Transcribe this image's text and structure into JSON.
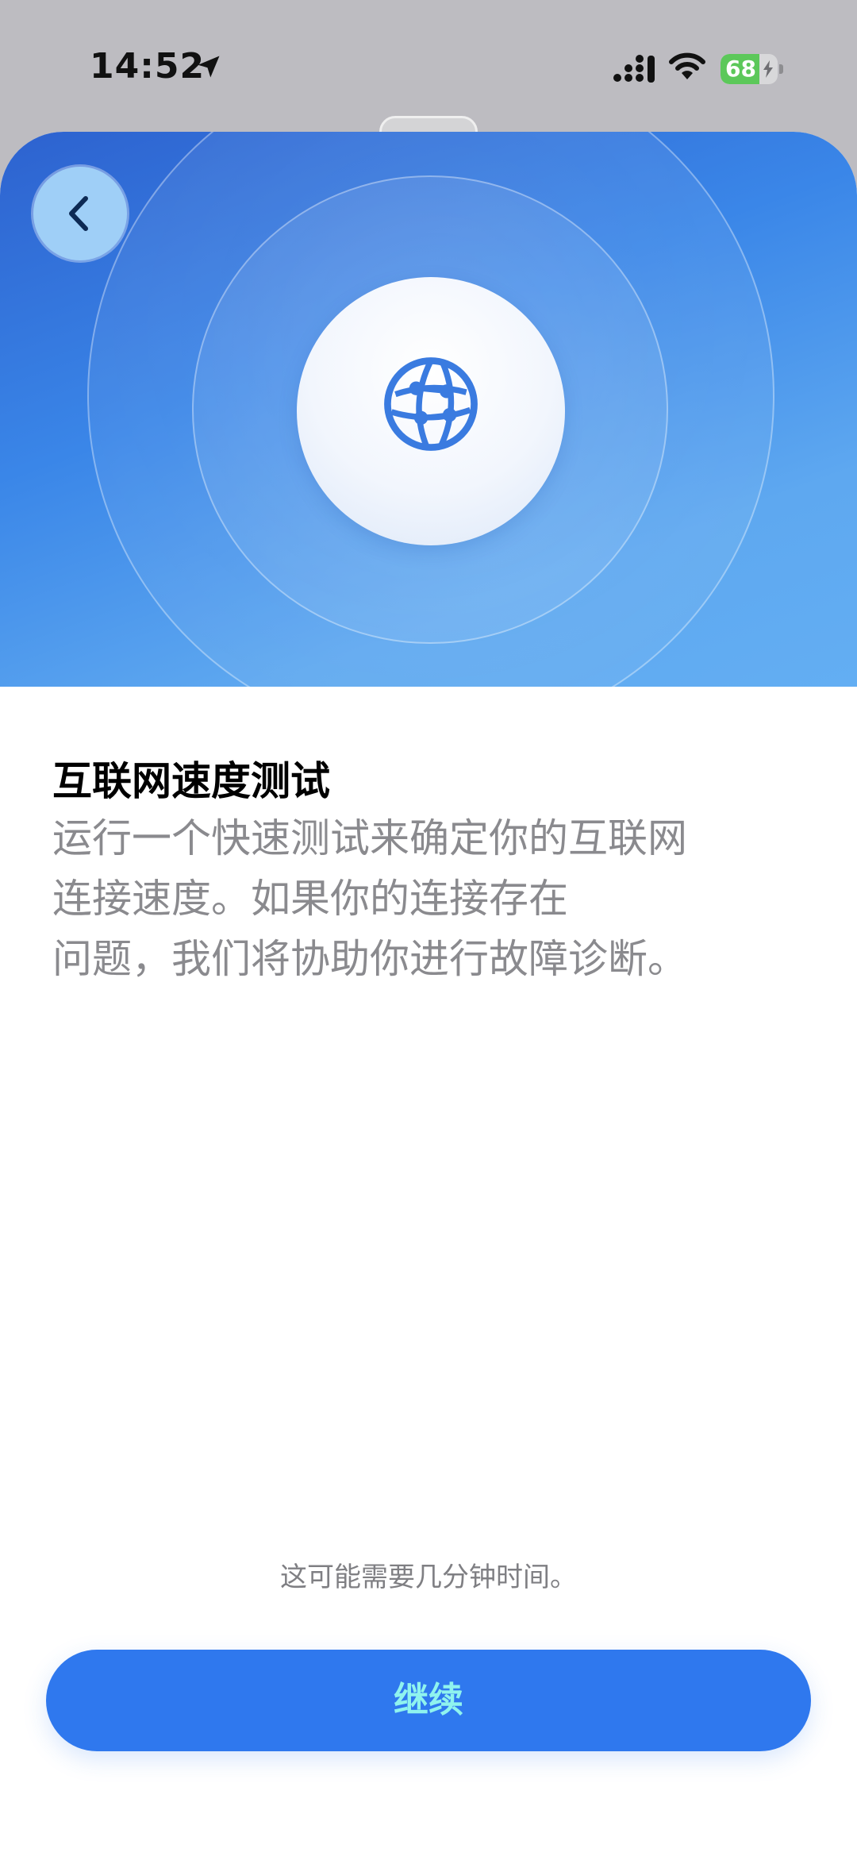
{
  "status_bar": {
    "time": "14:52",
    "battery_level": "68",
    "battery_fraction": 0.68,
    "icons": [
      "location-arrow-icon",
      "cellular-signal-icon",
      "wifi-icon",
      "battery-charging-icon"
    ]
  },
  "hero": {
    "icon": "globe-icon",
    "back_icon": "chevron-left-icon",
    "colors": {
      "gradient_start": "#2d62cf",
      "gradient_end": "#63aef3",
      "globe": "#3a7be0"
    }
  },
  "content": {
    "title": "互联网速度测试",
    "description": "运行一个快速测试来确定你的互联网\n连接速度。如果你的连接存在\n问题，我们将协助你进行故障诊断。"
  },
  "footer": {
    "note": "这可能需要几分钟时间。",
    "continue_label": "继续",
    "colors": {
      "button": "#2f78ee",
      "button_text": "#8ff3ee"
    }
  }
}
